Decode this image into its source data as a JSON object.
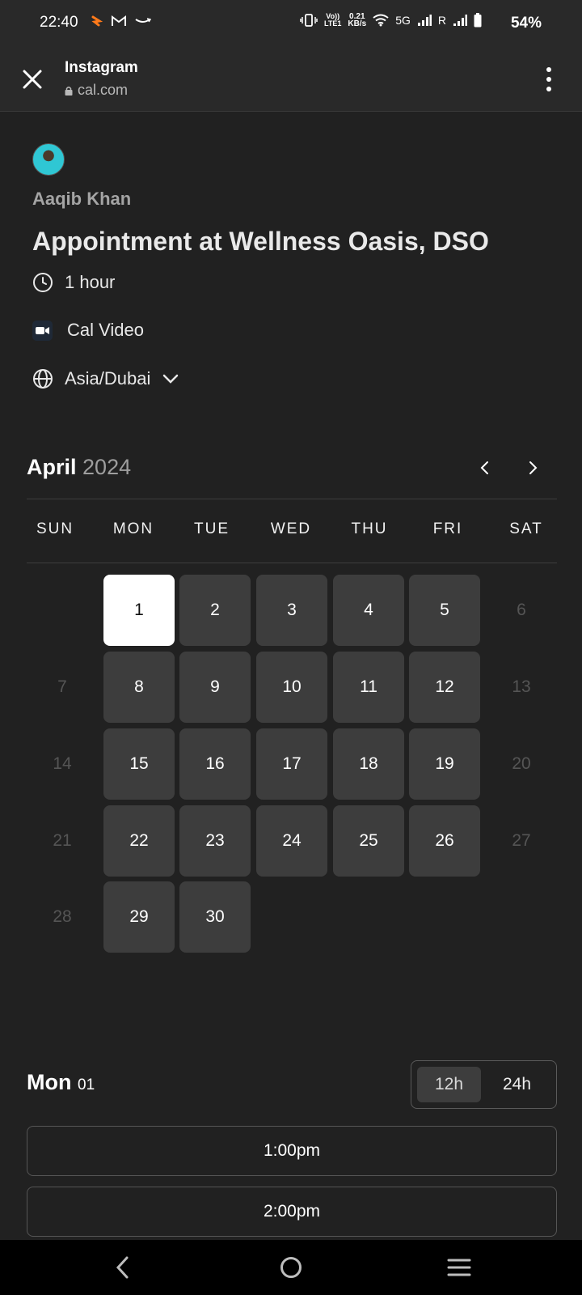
{
  "status_bar": {
    "time": "22:40",
    "net_speed_value": "0.21",
    "net_speed_unit": "KB/s",
    "volte_top": "Vo))",
    "volte_bottom": "LTE1",
    "network": "5G",
    "roaming": "R",
    "battery": "54%",
    "icons": [
      "swiggy-icon",
      "gmail-icon",
      "amazon-icon",
      "vibrate-icon",
      "wifi-icon",
      "signal-icon",
      "battery-icon"
    ]
  },
  "browser": {
    "title": "Instagram",
    "url": "cal.com"
  },
  "event": {
    "author": "Aaqib Khan",
    "title": "Appointment at Wellness Oasis, DSO",
    "duration": "1 hour",
    "location": "Cal Video",
    "timezone": "Asia/Dubai"
  },
  "calendar": {
    "month": "April",
    "year": "2024",
    "weekdays": [
      "SUN",
      "MON",
      "TUE",
      "WED",
      "THU",
      "FRI",
      "SAT"
    ],
    "weeks": [
      [
        "",
        "1",
        "2",
        "3",
        "4",
        "5",
        "6"
      ],
      [
        "7",
        "8",
        "9",
        "10",
        "11",
        "12",
        "13"
      ],
      [
        "14",
        "15",
        "16",
        "17",
        "18",
        "19",
        "20"
      ],
      [
        "21",
        "22",
        "23",
        "24",
        "25",
        "26",
        "27"
      ],
      [
        "28",
        "29",
        "30",
        "",
        "",
        "",
        ""
      ]
    ],
    "selected_day": "1"
  },
  "slots": {
    "date_day": "Mon",
    "date_num": "01",
    "format_12h": "12h",
    "format_24h": "24h",
    "active_format": "12h",
    "times": [
      "1:00pm",
      "2:00pm"
    ]
  },
  "colors": {
    "background": "#212121",
    "available_day": "#3d3d3d",
    "selected_day": "#ffffff",
    "muted_text": "#555555"
  }
}
